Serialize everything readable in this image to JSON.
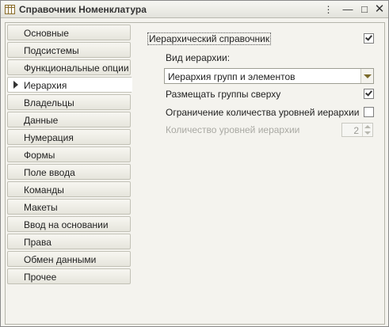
{
  "window": {
    "title": "Справочник Номенклатура",
    "icon": "table-icon",
    "controls": {
      "more": "⋮",
      "minimize": "—",
      "maximize": "□",
      "close": "✕"
    }
  },
  "sidebar": {
    "items": [
      {
        "label": "Основные",
        "active": false
      },
      {
        "label": "Подсистемы",
        "active": false
      },
      {
        "label": "Функциональные опции",
        "active": false
      },
      {
        "label": "Иерархия",
        "active": true
      },
      {
        "label": "Владельцы",
        "active": false
      },
      {
        "label": "Данные",
        "active": false
      },
      {
        "label": "Нумерация",
        "active": false
      },
      {
        "label": "Формы",
        "active": false
      },
      {
        "label": "Поле ввода",
        "active": false
      },
      {
        "label": "Команды",
        "active": false
      },
      {
        "label": "Макеты",
        "active": false
      },
      {
        "label": "Ввод на основании",
        "active": false
      },
      {
        "label": "Права",
        "active": false
      },
      {
        "label": "Обмен данными",
        "active": false
      },
      {
        "label": "Прочее",
        "active": false
      }
    ]
  },
  "panel": {
    "hierarchical": {
      "label": "Иерархический справочник",
      "checked": true
    },
    "hierarchy_kind": {
      "label": "Вид иерархии:",
      "value": "Иерархия групп и элементов"
    },
    "groups_on_top": {
      "label": "Размещать группы сверху",
      "checked": true
    },
    "limit_levels": {
      "label": "Ограничение количества уровней иерархии",
      "checked": false
    },
    "levels_count": {
      "label": "Количество уровней иерархии",
      "value": "2",
      "enabled": false
    }
  }
}
